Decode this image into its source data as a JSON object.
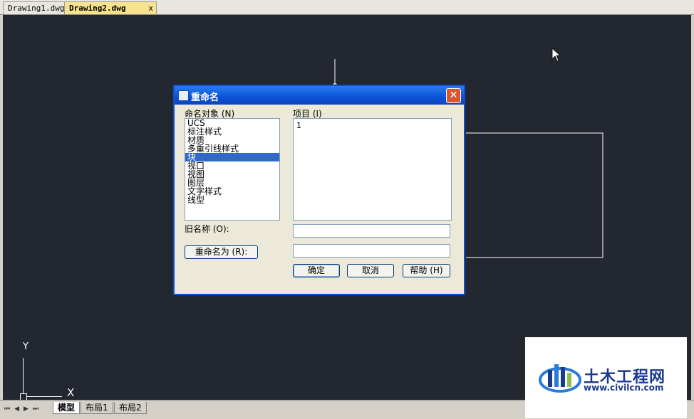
{
  "document_tabs": [
    {
      "label": "Drawing1.dwg"
    },
    {
      "label": "Drawing2.dwg",
      "close": "x"
    }
  ],
  "ucs": {
    "y_label": "Y",
    "x_label": "X"
  },
  "layout_tabs": [
    "模型",
    "布局1",
    "布局2"
  ],
  "dialog": {
    "title": "重命名",
    "close_symbol": "✕",
    "named_objects_label": "命名对象 (N)",
    "named_objects": [
      "UCS",
      "标注样式",
      "材质",
      "多重引线样式",
      "块",
      "视口",
      "视图",
      "图层",
      "文字样式",
      "线型"
    ],
    "selected_object": "块",
    "items_label": "项目 (I)",
    "items": [
      "1"
    ],
    "old_name_label": "旧名称 (O):",
    "old_name_value": "",
    "rename_to_button": "重命名为 (R):",
    "rename_to_value": "",
    "ok_button": "确定",
    "cancel_button": "取消",
    "help_button": "帮助 (H)"
  },
  "watermark": {
    "name": "土木工程网",
    "url": "www.civilcn.com"
  },
  "colors": {
    "canvas": "#232730",
    "title_bar": "#0a52d6",
    "selection": "#316ac5",
    "active_tab": "#f7e28e"
  }
}
